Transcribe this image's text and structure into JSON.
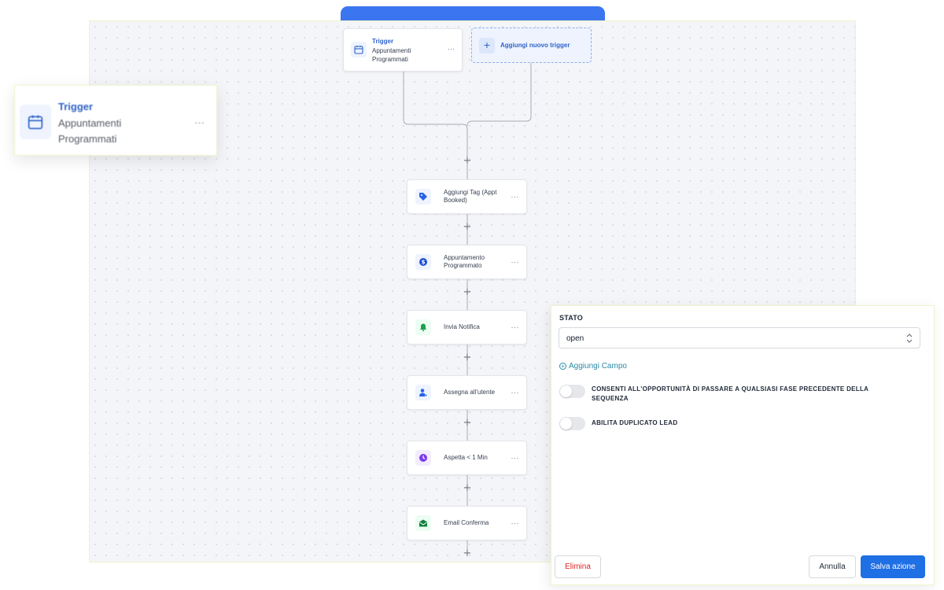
{
  "trigger": {
    "title": "Trigger",
    "name_line1": "Appuntamenti",
    "name_line2": "Programmati",
    "menu": "···",
    "icon": "calendar-icon"
  },
  "add_trigger": {
    "plus": "+",
    "label": "Aggiungi nuovo trigger"
  },
  "actions": [
    {
      "label": "Aggiungi Tag (Appt Booked)",
      "icon": "tag-icon",
      "color": "#2563eb"
    },
    {
      "label": "Appuntamento Programmato",
      "icon": "dollar-icon",
      "color": "#1d4ed8"
    },
    {
      "label": "Invia Notifica",
      "icon": "bell-icon",
      "color": "#16a34a"
    },
    {
      "label": "Assegna all'utente",
      "icon": "user-assign-icon",
      "color": "#2563eb"
    },
    {
      "label": "Aspetta < 1 Min",
      "icon": "clock-icon",
      "color": "#7c3aed"
    },
    {
      "label": "Email Conferma",
      "icon": "envelope-icon",
      "color": "#15803d"
    }
  ],
  "add_step": "+",
  "action_menu": "···",
  "panel": {
    "stato_label": "STATO",
    "stato_value": "open",
    "add_field": "Aggiungi Campo",
    "toggle1_label": "CONSENTI ALL'OPPORTUNITÀ DI PASSARE A QUALSIASI FASE PRECEDENTE DELLA SEQUENZA",
    "toggle2_label": "ABILITA DUPLICATO LEAD",
    "delete": "Elimina",
    "cancel": "Annulla",
    "save": "Salva azione"
  },
  "colors": {
    "accent": "#1f6fe5",
    "trigger_text": "#2e63c8",
    "danger": "#dc2626",
    "link": "#2a8ba6"
  }
}
